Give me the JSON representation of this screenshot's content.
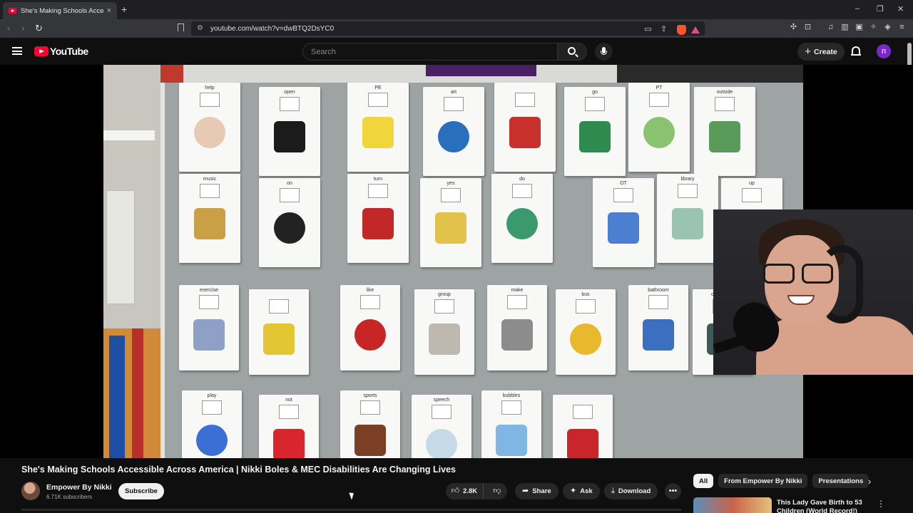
{
  "browser": {
    "tab_title": "She's Making Schools Accessib",
    "tab_close": "×",
    "new_tab": "+",
    "url": "youtube.com/watch?v=dwBTQ2DsYC0",
    "window_controls": [
      "–",
      "❐",
      "✕"
    ]
  },
  "masthead": {
    "logo_text": "YouTube",
    "search_placeholder": "Search",
    "create_label": "Create",
    "avatar_letter": "n",
    "avatar_color": "#7a28c9"
  },
  "video": {
    "cards": [
      {
        "label": "help"
      },
      {
        "label": "open"
      },
      {
        "label": "PE"
      },
      {
        "label": "art"
      },
      {
        "label": ""
      },
      {
        "label": "go"
      },
      {
        "label": "PT"
      },
      {
        "label": "outside"
      },
      {
        "label": "music"
      },
      {
        "label": "on"
      },
      {
        "label": "turn"
      },
      {
        "label": "yes"
      },
      {
        "label": "do"
      },
      {
        "label": "OT"
      },
      {
        "label": "library"
      },
      {
        "label": "up"
      },
      {
        "label": "exercise"
      },
      {
        "label": ""
      },
      {
        "label": "like"
      },
      {
        "label": "group"
      },
      {
        "label": "make"
      },
      {
        "label": "bus"
      },
      {
        "label": "bathroom"
      },
      {
        "label": "classroom"
      },
      {
        "label": "play"
      },
      {
        "label": "not"
      },
      {
        "label": "sports"
      },
      {
        "label": "speech"
      },
      {
        "label": "bubbles"
      },
      {
        "label": ""
      }
    ]
  },
  "watch": {
    "title": "She's Making Schools Accessible Across America | Nikki Boles & MEC Disabilities Are Changing Lives",
    "channel_name": "Empower By Nikki",
    "subscribers": "6.71K subscribers",
    "subscribe_label": "Subscribe",
    "likes": "2.8K",
    "share_label": "Share",
    "ask_label": "Ask",
    "download_label": "Download"
  },
  "sidebar": {
    "chips": [
      {
        "label": "All",
        "active": true
      },
      {
        "label": "From Empower By Nikki",
        "active": false
      },
      {
        "label": "Presentations",
        "active": false
      }
    ],
    "rec_title": "This Lady Gave Birth to 53 Children (World Record!)"
  }
}
